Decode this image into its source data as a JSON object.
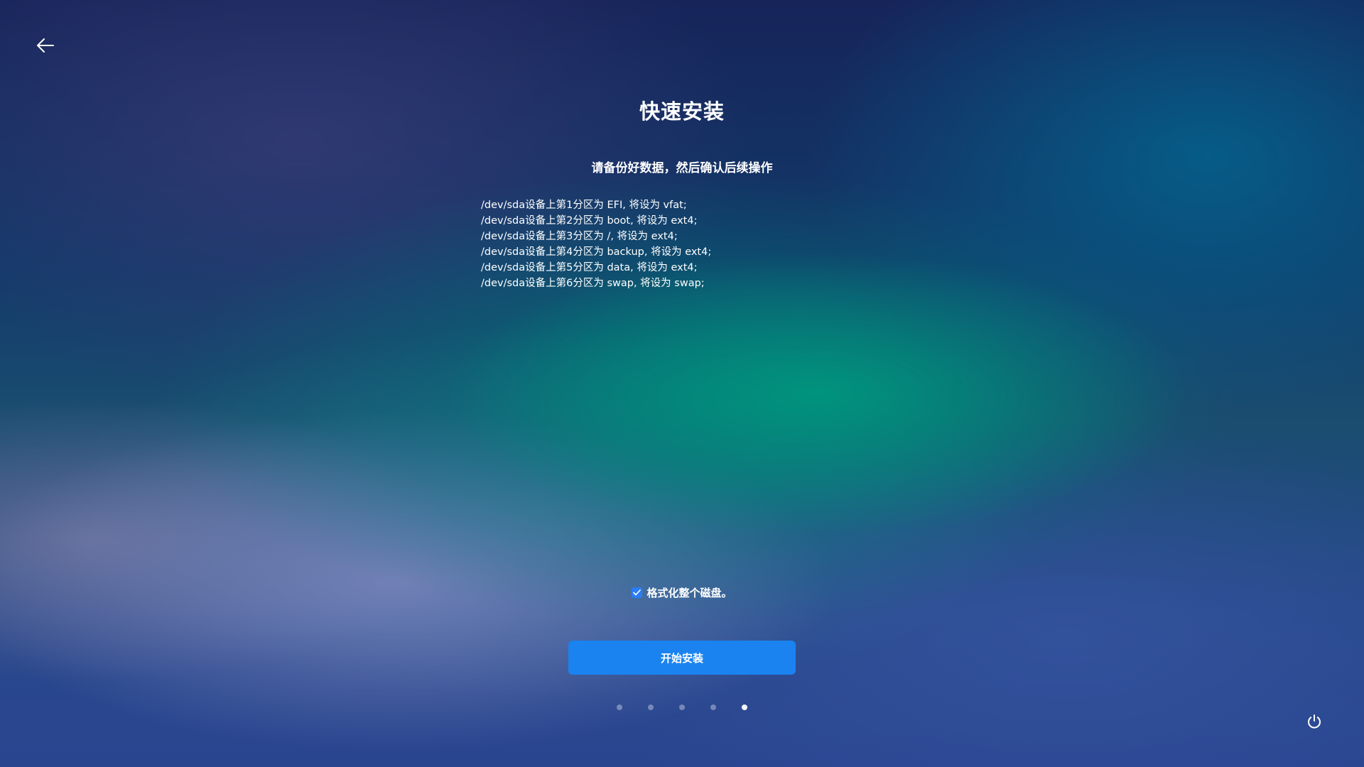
{
  "header": {
    "back_icon": "arrow-left-icon"
  },
  "page": {
    "title": "快速安装",
    "subtitle": "请备份好数据，然后确认后续操作"
  },
  "partitions": [
    "/dev/sda设备上第1分区为 EFI, 将设为 vfat;",
    "/dev/sda设备上第2分区为 boot, 将设为 ext4;",
    "/dev/sda设备上第3分区为 /, 将设为 ext4;",
    "/dev/sda设备上第4分区为 backup, 将设为 ext4;",
    "/dev/sda设备上第5分区为 data, 将设为 ext4;",
    "/dev/sda设备上第6分区为 swap, 将设为 swap;"
  ],
  "format_option": {
    "label": "格式化整个磁盘。",
    "checked": true
  },
  "install_button": {
    "label": "开始安装",
    "color": "#1a83f0"
  },
  "steps": {
    "total": 5,
    "current": 5
  },
  "footer": {
    "power_icon": "power-icon"
  }
}
